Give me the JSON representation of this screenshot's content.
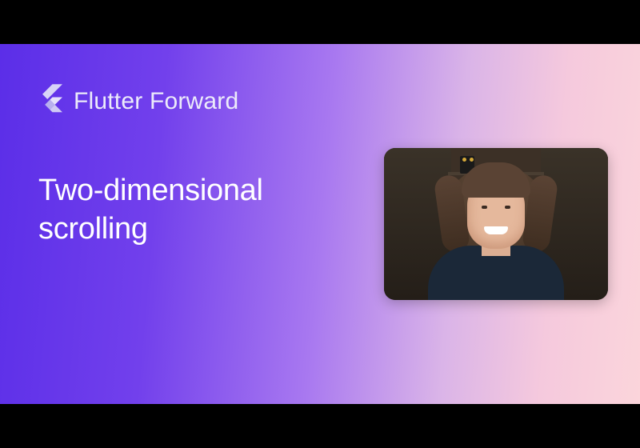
{
  "brand": {
    "name": "Flutter Forward"
  },
  "title": "Two-dimensional\nscrolling",
  "colors": {
    "gradient_start": "#5b2ee8",
    "gradient_end": "#fbd5db",
    "text": "#ffffff"
  }
}
